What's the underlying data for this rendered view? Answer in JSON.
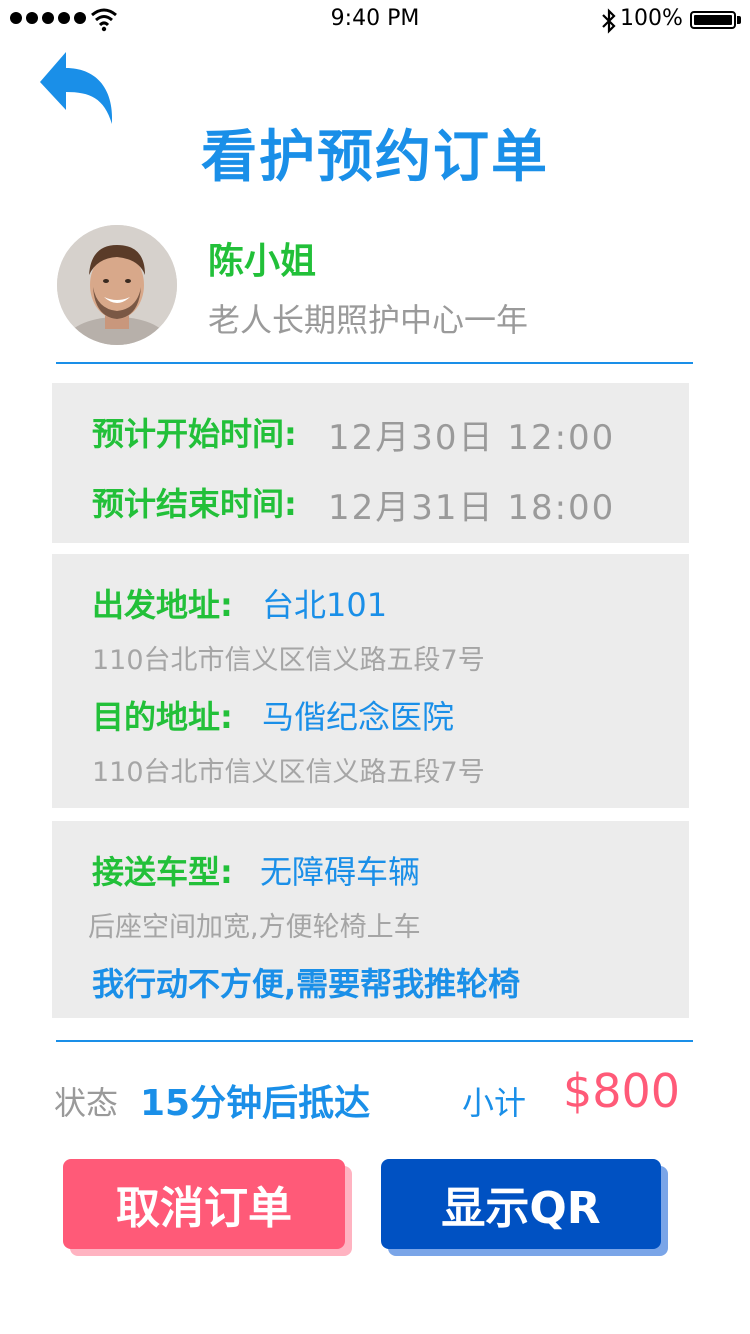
{
  "status_bar": {
    "time": "9:40 PM",
    "battery": "100%"
  },
  "header": {
    "title": "看护预约订单"
  },
  "profile": {
    "name": "陈小姐",
    "subtitle": "老人长期照护中心一年"
  },
  "schedule": {
    "start_label": "预计开始时间:",
    "start_value": "12月30日  12:00",
    "end_label": "预计结束时间:",
    "end_value": "12月31日  18:00"
  },
  "route": {
    "depart_label": "出发地址:",
    "depart_name": "台北101",
    "depart_address": "110台北市信义区信义路五段7号",
    "dest_label": "目的地址:",
    "dest_name": "马偕纪念医院",
    "dest_address": "110台北市信义区信义路五段7号"
  },
  "vehicle": {
    "label": "接送车型:",
    "value": "无障碍车辆",
    "description": "后座空间加宽,方便轮椅上车",
    "note": "我行动不方便,需要帮我推轮椅"
  },
  "summary": {
    "status_label": "状态",
    "status_value": "15分钟后抵达",
    "subtotal_label": "小计",
    "subtotal_value": "$800"
  },
  "actions": {
    "cancel_label": "取消订单",
    "qr_label": "显示QR"
  },
  "colors": {
    "blue": "#1a8fe8",
    "green": "#22c039",
    "pink": "#ff5a78",
    "dark_blue": "#0051c2",
    "card_bg": "#ececec"
  }
}
